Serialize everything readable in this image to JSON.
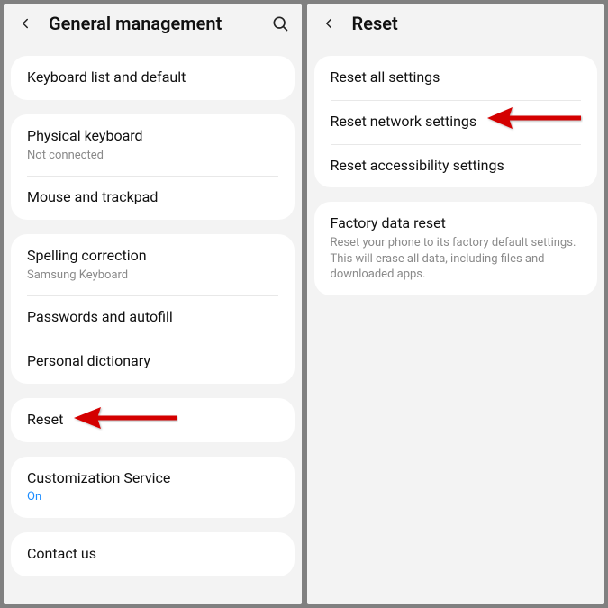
{
  "left": {
    "title": "General management",
    "groups": [
      {
        "items": [
          {
            "title": "Keyboard list and default"
          }
        ]
      },
      {
        "items": [
          {
            "title": "Physical keyboard",
            "sub": "Not connected"
          },
          {
            "title": "Mouse and trackpad"
          }
        ]
      },
      {
        "items": [
          {
            "title": "Spelling correction",
            "sub": "Samsung Keyboard"
          },
          {
            "title": "Passwords and autofill"
          },
          {
            "title": "Personal dictionary"
          }
        ]
      },
      {
        "items": [
          {
            "title": "Reset"
          }
        ]
      },
      {
        "items": [
          {
            "title": "Customization Service",
            "sub": "On",
            "subClass": "blue"
          }
        ]
      },
      {
        "items": [
          {
            "title": "Contact us"
          }
        ]
      }
    ]
  },
  "right": {
    "title": "Reset",
    "groups": [
      {
        "items": [
          {
            "title": "Reset all settings"
          },
          {
            "title": "Reset network settings"
          },
          {
            "title": "Reset accessibility settings"
          }
        ]
      },
      {
        "items": [
          {
            "title": "Factory data reset",
            "sub": "Reset your phone to its factory default settings. This will erase all data, including files and downloaded apps."
          }
        ]
      }
    ]
  }
}
